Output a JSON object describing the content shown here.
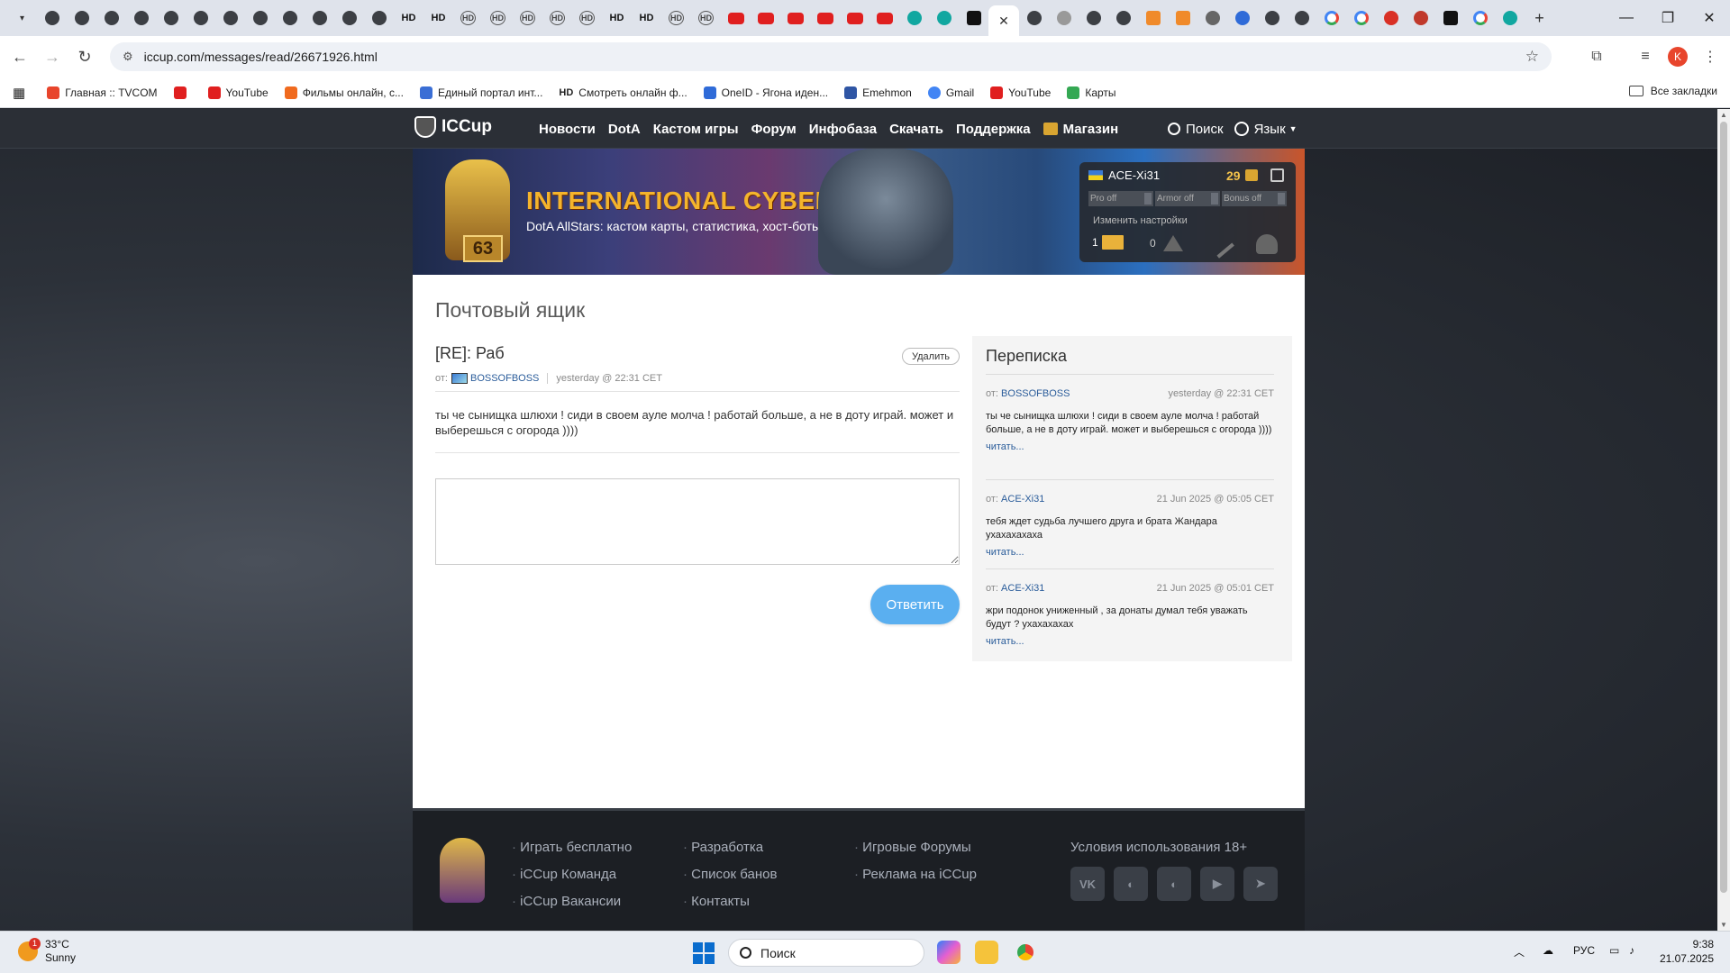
{
  "browser": {
    "active_tab_close": "✕",
    "new_tab": "+",
    "window_controls": {
      "minimize": "—",
      "maximize": "❐",
      "close": "✕"
    },
    "url": "iccup.com/messages/read/26671926.html",
    "profile_initial": "K",
    "tab_labels": {
      "hd": "HD"
    },
    "bookmarks": [
      {
        "label": "Главная :: TVCOM",
        "icon": "tvcom-icon",
        "color": "#e8452c"
      },
      {
        "label": "",
        "icon": "youtube-icon",
        "color": "#e01f1f"
      },
      {
        "label": "YouTube",
        "icon": "youtube-icon",
        "color": "#e01f1f"
      },
      {
        "label": "Фильмы онлайн, с...",
        "icon": "kinopoisk-icon",
        "color": "#f06a1e"
      },
      {
        "label": "Единый портал инт...",
        "icon": "portal-icon",
        "color": "#3a6ed5"
      },
      {
        "label": "Смотреть онлайн ф...",
        "icon": "hd-icon",
        "color": "#111111"
      },
      {
        "label": "OneID - Ягона иден...",
        "icon": "oneid-icon",
        "color": "#2f6bd8"
      },
      {
        "label": "Emehmon",
        "icon": "emehmon-icon",
        "color": "#2f55a4"
      },
      {
        "label": "Gmail",
        "icon": "google-icon",
        "color": "#4285f4"
      },
      {
        "label": "YouTube",
        "icon": "youtube-icon",
        "color": "#e01f1f"
      },
      {
        "label": "Карты",
        "icon": "maps-icon",
        "color": "#34a853"
      }
    ],
    "all_bookmarks": "Все закладки"
  },
  "site": {
    "logo": "ICCup",
    "nav": [
      "Новости",
      "DotA",
      "Кастом игры",
      "Форум",
      "Инфобаза",
      "Скачать",
      "Поддержка"
    ],
    "shop": "Магазин",
    "search": "Поиск",
    "language": "Язык",
    "banner": {
      "title": "INTERNATIONAL CYBER CUP",
      "subtitle": "DotA AllStars: кастом карты, статистика, хост-боты",
      "level": "63"
    },
    "user_panel": {
      "username": "ACE-Xi31",
      "gold": "29",
      "toggles": [
        "Pro off",
        "Armor off",
        "Bonus off"
      ],
      "settings": "Изменить настройки",
      "messages_count": "1",
      "warnings_count": "0"
    }
  },
  "mailbox": {
    "title": "Почтовый ящик",
    "subject": "[RE]: Раб",
    "delete": "Удалить",
    "from_label": "от:",
    "sender": "BOSSOFBOSS",
    "timestamp": "yesterday @ 22:31 CET",
    "body": "ты че сынищка шлюхи ! сиди в своем ауле молча ! работай больше, а не в доту играй. может и выберешься с огорода ))))",
    "reply_button": "Ответить"
  },
  "correspondence": {
    "title": "Переписка",
    "items": [
      {
        "from_label": "от:",
        "sender": "BOSSOFBOSS",
        "time": "yesterday @ 22:31 CET",
        "text": "ты че сынищка шлюхи ! сиди в своем ауле молча ! работай больше, а не в доту играй. может и выберешься с огорода ))))",
        "read": "читать..."
      },
      {
        "from_label": "от:",
        "sender": "ACE-Xi31",
        "time": "21 Jun 2025 @ 05:05 CET",
        "text": "тебя ждет судьба лучшего друга и брата Жандара ухахахахаха",
        "read": "читать..."
      },
      {
        "from_label": "от:",
        "sender": "ACE-Xi31",
        "time": "21 Jun 2025 @ 05:01 CET",
        "text": "жри подонок униженный , за донаты думал тебя уважать будут ? ухахахахах",
        "read": "читать..."
      }
    ]
  },
  "footer": {
    "col1": [
      "Играть бесплатно",
      "iCCup Команда",
      "iCCup Вакансии"
    ],
    "col2": [
      "Разработка",
      "Список банов",
      "Контакты"
    ],
    "col3": [
      "Игровые Форумы",
      "Реклама на iCCup"
    ],
    "terms": "Условия использования 18+",
    "socials": [
      "vk-icon",
      "discord-icon",
      "discord-icon",
      "youtube-icon",
      "telegram-icon"
    ],
    "social_labels": {
      "vk": "VK"
    }
  },
  "taskbar": {
    "weather_badge": "1",
    "temperature": "33°C",
    "condition": "Sunny",
    "search_placeholder": "Поиск",
    "language": "РУС",
    "time": "9:38",
    "date": "21.07.2025"
  }
}
